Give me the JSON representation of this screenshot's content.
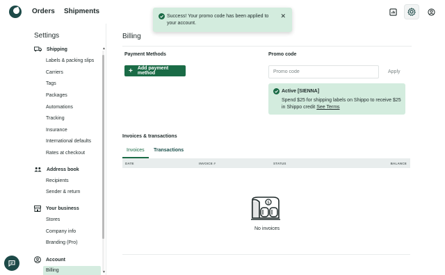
{
  "header": {
    "nav": [
      {
        "label": "Orders"
      },
      {
        "label": "Shipments"
      }
    ],
    "icons": [
      "reports-icon",
      "settings-icon",
      "account-icon"
    ]
  },
  "toast": {
    "message": "Success! Your promo code has been applied to your account.",
    "close": "✕"
  },
  "sidebar": {
    "title": "Settings",
    "sections": [
      {
        "label": "Shipping",
        "icon": "truck-icon",
        "items": [
          "Labels & packing slips",
          "Carriers",
          "Tags",
          "Packages",
          "Automations",
          "Tracking",
          "Insurance",
          "International defaults",
          "Rates at checkout"
        ]
      },
      {
        "label": "Address book",
        "icon": "people-icon",
        "items": [
          "Recipients",
          "Sender & return"
        ]
      },
      {
        "label": "Your business",
        "icon": "store-icon",
        "items": [
          "Stores",
          "Company info",
          "Branding (Pro)"
        ]
      },
      {
        "label": "Account",
        "icon": "account-circle-icon",
        "items": [
          "Billing"
        ]
      }
    ],
    "active_item": "Billing"
  },
  "main": {
    "title": "Billing",
    "payment_methods": {
      "label": "Payment Methods",
      "button": "Add payment method"
    },
    "promo": {
      "label": "Promo code",
      "placeholder": "Promo code",
      "value": "",
      "apply": "Apply",
      "active_title": "Active [SIENNA]",
      "active_desc": "Spend $25 for shipping labels on Shippo to receive $25 in Shippo credit",
      "link": "See Terms"
    },
    "invoices": {
      "title": "Invoices & transactions",
      "tabs": [
        {
          "label": "Invoices",
          "selected": true
        },
        {
          "label": "Transactions",
          "selected": false
        }
      ],
      "columns": [
        "DATE",
        "INVOICE #",
        "STATUS",
        "BALANCE"
      ],
      "rows": [],
      "empty_text": "No invoices"
    }
  },
  "colors": {
    "brand": "#1d4a48",
    "accent": "#1a6b46",
    "success_bg": "#d3ecde"
  }
}
